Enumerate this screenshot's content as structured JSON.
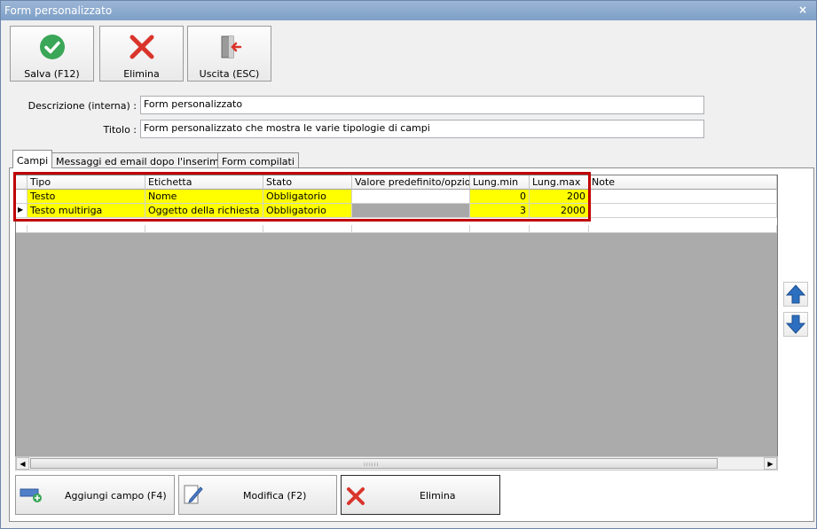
{
  "window": {
    "title": "Form personalizzato",
    "close_label": "×"
  },
  "toolbar": {
    "save_label": "Salva (F12)",
    "delete_label": "Elimina",
    "exit_label": "Uscita (ESC)"
  },
  "form": {
    "description_label": "Descrizione (interna) :",
    "description_value": "Form personalizzato",
    "title_label": "Titolo :",
    "title_value": "Form personalizzato che mostra le varie tipologie di campi"
  },
  "tabs": [
    {
      "label": "Campi",
      "active": true
    },
    {
      "label": "Messaggi ed email dopo l'inserimento",
      "active": false
    },
    {
      "label": "Form compilati",
      "active": false
    }
  ],
  "grid": {
    "columns": [
      "Tipo",
      "Etichetta",
      "Stato",
      "Valore predefinito/opzioni",
      "Lung.min",
      "Lung.max",
      "Note"
    ],
    "rows": [
      {
        "tipo": "Testo",
        "etichetta": "Nome",
        "stato": "Obbligatorio",
        "valore": "",
        "lung_min": "0",
        "lung_max": "200",
        "note": ""
      },
      {
        "tipo": "Testo multiriga",
        "etichetta": "Oggetto della richiesta",
        "stato": "Obbligatorio",
        "valore": "",
        "lung_min": "3",
        "lung_max": "2000",
        "note": ""
      }
    ],
    "current_row_marker": "▶",
    "highlight_color": "#ffff00",
    "frame_color": "#c00000"
  },
  "bottom": {
    "add_label": "Aggiungi campo (F4)",
    "edit_label": "Modifica (F2)",
    "delete_label": "Elimina"
  },
  "colors": {
    "accent_green": "#3aa657",
    "accent_red": "#d9352b",
    "arrow_blue": "#2c6fc0"
  }
}
